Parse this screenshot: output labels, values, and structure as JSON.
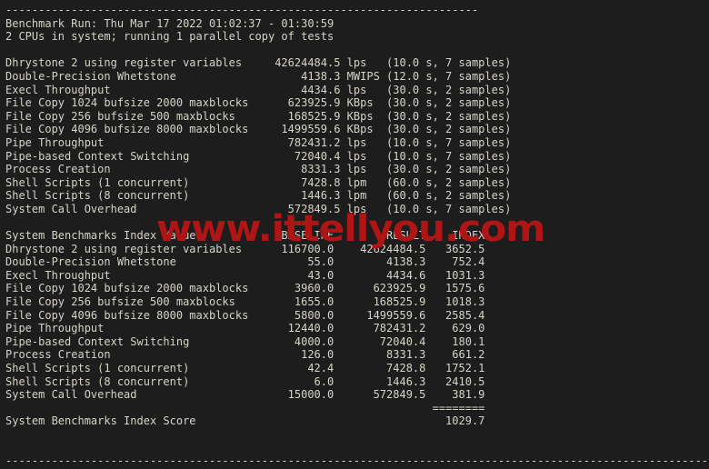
{
  "terminal": {
    "background_color": "#1d1d1d",
    "text_color": "#d6d3c8",
    "watermark_color": "#b01515",
    "top_rule": "------------------------------------------------------------------------",
    "bottom_rule": "------------------------------------------------------------------------------------------------------------",
    "header": {
      "run_line": "Benchmark Run: Thu Mar 17 2022 01:02:37 - 01:30:59",
      "cpu_line": "2 CPUs in system; running 1 parallel copy of tests"
    },
    "raw_results": {
      "rows": [
        {
          "name": "Dhrystone 2 using register variables",
          "value": "42624484.5",
          "unit": "lps",
          "timing": "(10.0 s, 7 samples)"
        },
        {
          "name": "Double-Precision Whetstone",
          "value": "4138.3",
          "unit": "MWIPS",
          "timing": "(12.0 s, 7 samples)"
        },
        {
          "name": "Execl Throughput",
          "value": "4434.6",
          "unit": "lps",
          "timing": "(30.0 s, 2 samples)"
        },
        {
          "name": "File Copy 1024 bufsize 2000 maxblocks",
          "value": "623925.9",
          "unit": "KBps",
          "timing": "(30.0 s, 2 samples)"
        },
        {
          "name": "File Copy 256 bufsize 500 maxblocks",
          "value": "168525.9",
          "unit": "KBps",
          "timing": "(30.0 s, 2 samples)"
        },
        {
          "name": "File Copy 4096 bufsize 8000 maxblocks",
          "value": "1499559.6",
          "unit": "KBps",
          "timing": "(30.0 s, 2 samples)"
        },
        {
          "name": "Pipe Throughput",
          "value": "782431.2",
          "unit": "lps",
          "timing": "(10.0 s, 7 samples)"
        },
        {
          "name": "Pipe-based Context Switching",
          "value": "72040.4",
          "unit": "lps",
          "timing": "(10.0 s, 7 samples)"
        },
        {
          "name": "Process Creation",
          "value": "8331.3",
          "unit": "lps",
          "timing": "(30.0 s, 2 samples)"
        },
        {
          "name": "Shell Scripts (1 concurrent)",
          "value": "7428.8",
          "unit": "lpm",
          "timing": "(60.0 s, 2 samples)"
        },
        {
          "name": "Shell Scripts (8 concurrent)",
          "value": "1446.3",
          "unit": "lpm",
          "timing": "(60.0 s, 2 samples)"
        },
        {
          "name": "System Call Overhead",
          "value": "572849.5",
          "unit": "lps",
          "timing": "(10.0 s, 7 samples)"
        }
      ]
    },
    "index_table": {
      "title": "System Benchmarks Index Values",
      "columns": [
        "BASELINE",
        "RESULT",
        "INDEX"
      ],
      "rows": [
        {
          "name": "Dhrystone 2 using register variables",
          "baseline": "116700.0",
          "result": "42624484.5",
          "index": "3652.5"
        },
        {
          "name": "Double-Precision Whetstone",
          "baseline": "55.0",
          "result": "4138.3",
          "index": "752.4"
        },
        {
          "name": "Execl Throughput",
          "baseline": "43.0",
          "result": "4434.6",
          "index": "1031.3"
        },
        {
          "name": "File Copy 1024 bufsize 2000 maxblocks",
          "baseline": "3960.0",
          "result": "623925.9",
          "index": "1575.6"
        },
        {
          "name": "File Copy 256 bufsize 500 maxblocks",
          "baseline": "1655.0",
          "result": "168525.9",
          "index": "1018.3"
        },
        {
          "name": "File Copy 4096 bufsize 8000 maxblocks",
          "baseline": "5800.0",
          "result": "1499559.6",
          "index": "2585.4"
        },
        {
          "name": "Pipe Throughput",
          "baseline": "12440.0",
          "result": "782431.2",
          "index": "629.0"
        },
        {
          "name": "Pipe-based Context Switching",
          "baseline": "4000.0",
          "result": "72040.4",
          "index": "180.1"
        },
        {
          "name": "Process Creation",
          "baseline": "126.0",
          "result": "8331.3",
          "index": "661.2"
        },
        {
          "name": "Shell Scripts (1 concurrent)",
          "baseline": "42.4",
          "result": "7428.8",
          "index": "1752.1"
        },
        {
          "name": "Shell Scripts (8 concurrent)",
          "baseline": "6.0",
          "result": "1446.3",
          "index": "2410.5"
        },
        {
          "name": "System Call Overhead",
          "baseline": "15000.0",
          "result": "572849.5",
          "index": "381.9"
        }
      ],
      "score_divider": "========",
      "score_label": "System Benchmarks Index Score",
      "score_value": "1029.7"
    },
    "watermark_text": "www.ittellyou.com"
  }
}
